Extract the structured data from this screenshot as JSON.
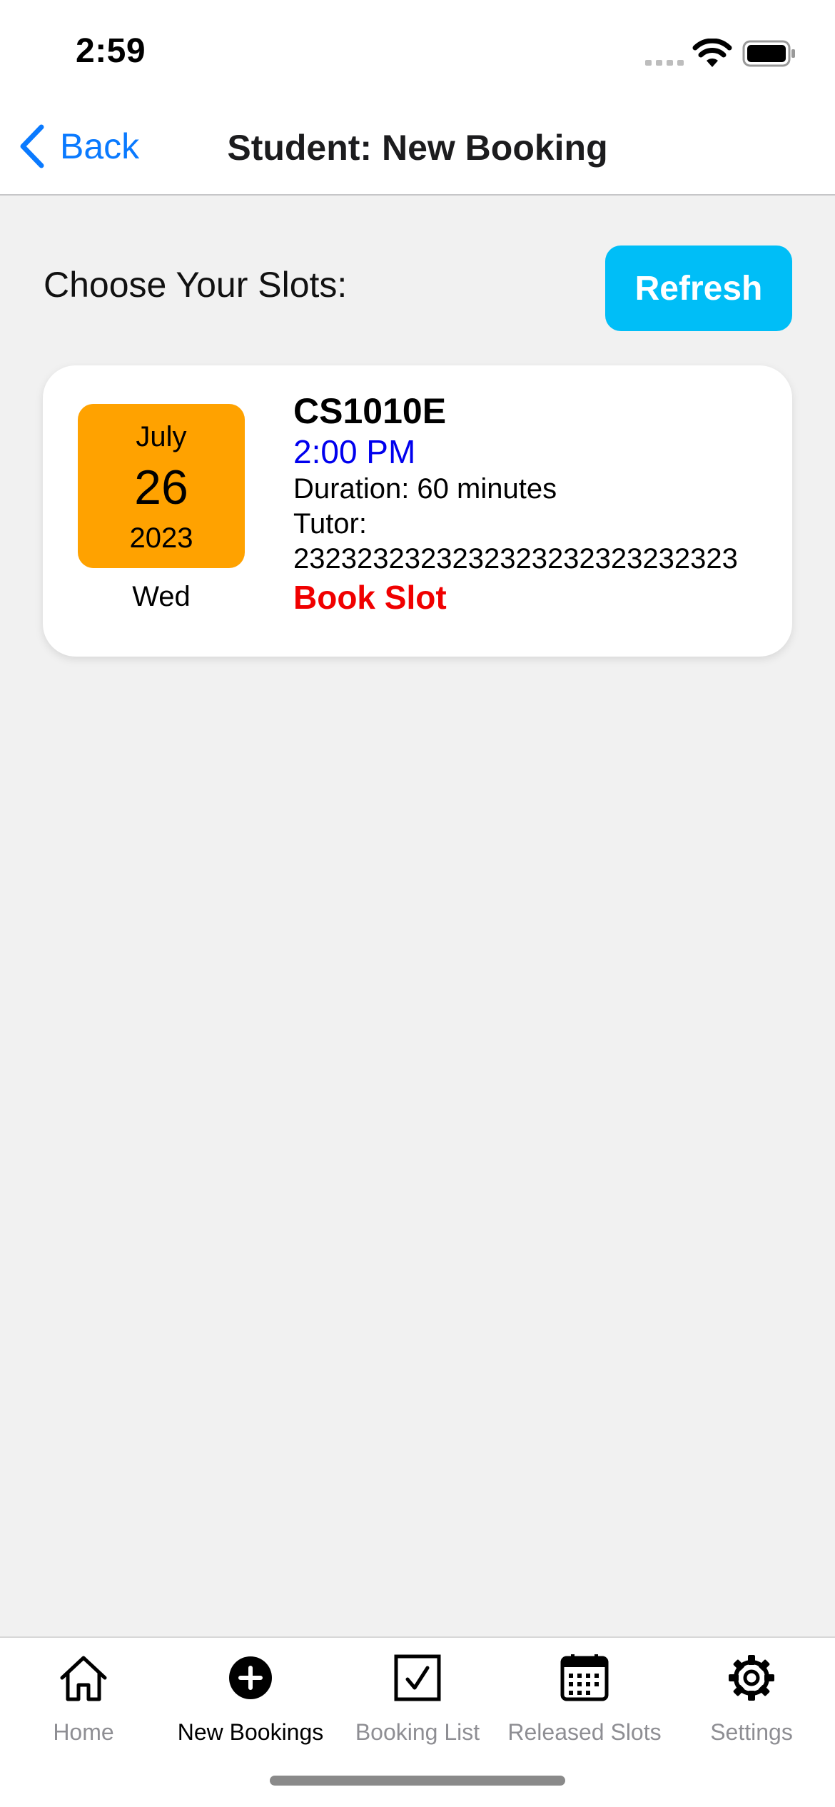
{
  "status_bar": {
    "time": "2:59"
  },
  "nav": {
    "back_label": "Back",
    "title": "Student: New Booking"
  },
  "main": {
    "heading": "Choose Your Slots:",
    "refresh_label": "Refresh"
  },
  "slot": {
    "month": "July",
    "day": "26",
    "year": "2023",
    "weekday": "Wed",
    "course_code": "CS1010E",
    "time": "2:00 PM",
    "duration": "Duration: 60 minutes",
    "tutor_label": "Tutor:",
    "tutor_id": "2323232323232323232323232323",
    "book_label": "Book Slot"
  },
  "tabs": [
    {
      "label": "Home",
      "icon": "house-icon",
      "active": false
    },
    {
      "label": "New Bookings",
      "icon": "plus-circle-icon",
      "active": true
    },
    {
      "label": "Booking List",
      "icon": "checkbox-icon",
      "active": false
    },
    {
      "label": "Released Slots",
      "icon": "calendar-icon",
      "active": false
    },
    {
      "label": "Settings",
      "icon": "gear-icon",
      "active": false
    }
  ],
  "colors": {
    "accent_blue": "#0a7aff",
    "refresh_button": "#00bef7",
    "date_badge": "#ffa200",
    "slot_time": "#0000ee",
    "book_slot": "#f00000",
    "background": "#f1f1f1"
  }
}
